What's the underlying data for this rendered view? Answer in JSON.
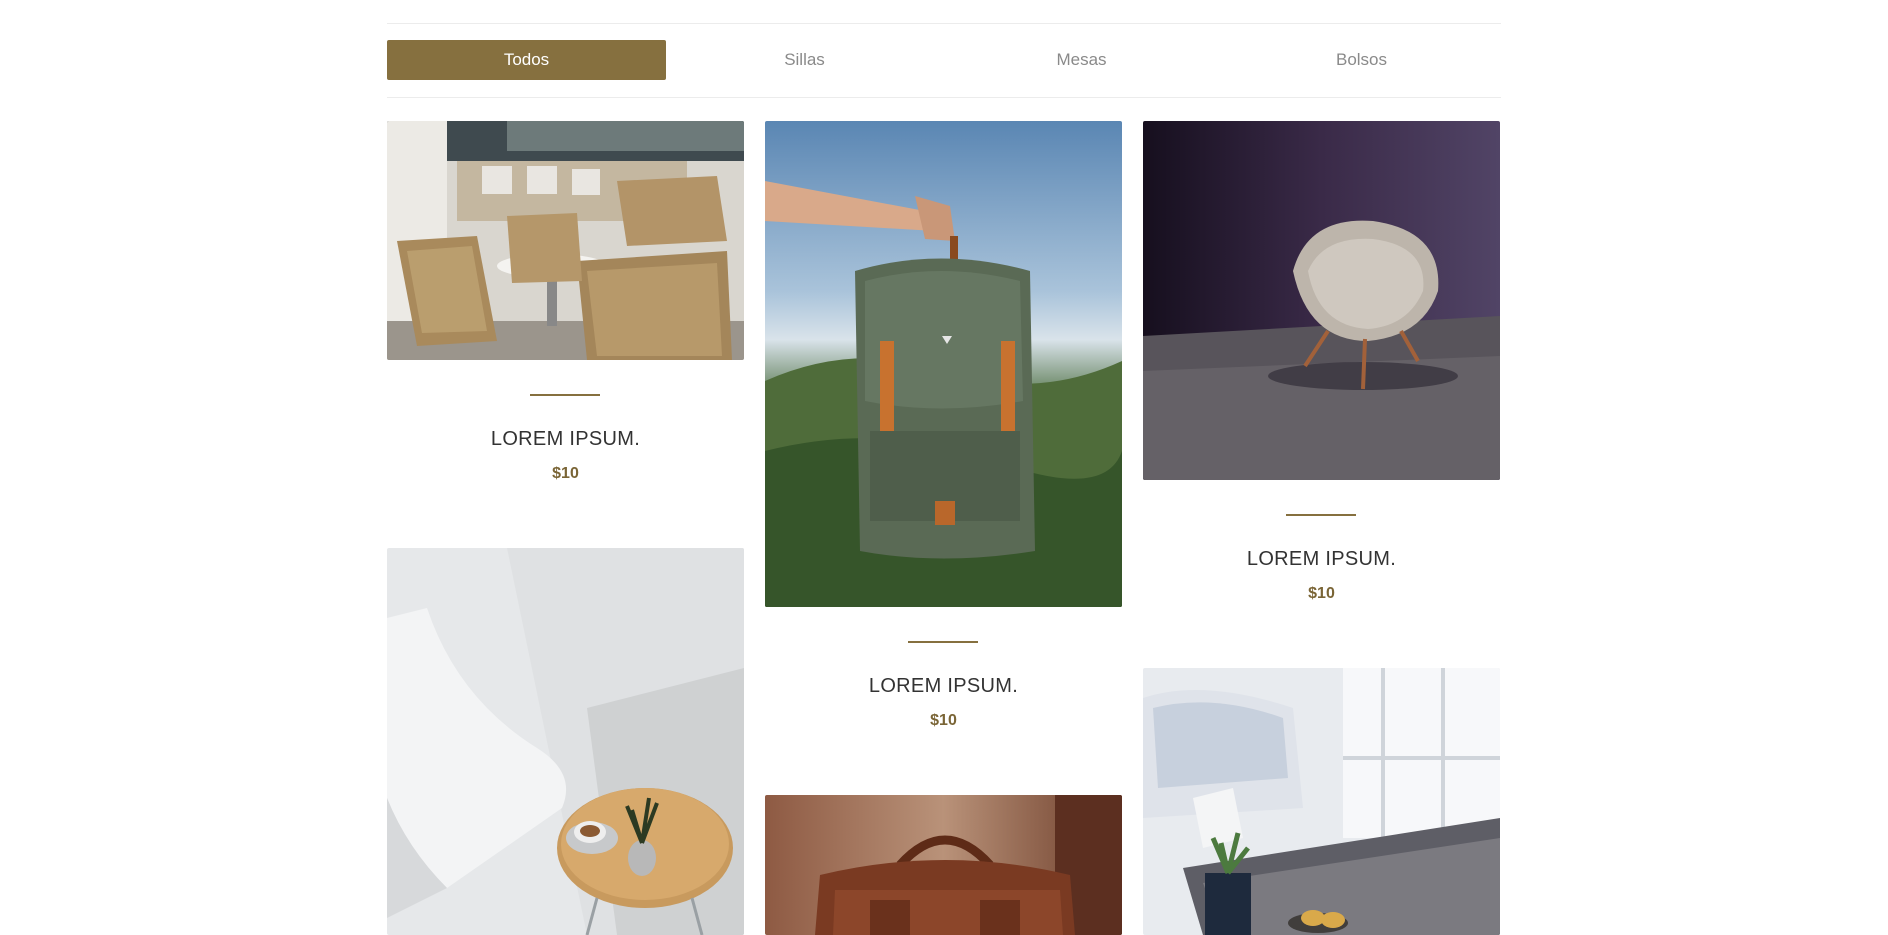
{
  "tabs": [
    {
      "label": "Todos",
      "active": true
    },
    {
      "label": "Sillas",
      "active": false
    },
    {
      "label": "Mesas",
      "active": false
    },
    {
      "label": "Bolsos",
      "active": false
    }
  ],
  "products": [
    {
      "title": "LOREM IPSUM.",
      "price": "$10",
      "image": "wicker-chairs-terrace-photo"
    },
    {
      "title": "LOREM IPSUM.",
      "price": "$10",
      "image": "green-backpack-mountains-photo"
    },
    {
      "title": "LOREM IPSUM.",
      "price": "$10",
      "image": "grey-shell-chair-photo"
    },
    {
      "image": "white-chair-coffee-table-photo"
    },
    {
      "image": "brown-leather-bag-photo"
    },
    {
      "image": "wooden-table-plant-photo"
    }
  ],
  "colors": {
    "accent": "#86703f",
    "tab_text": "#8a8a8a",
    "title_text": "#333333"
  }
}
